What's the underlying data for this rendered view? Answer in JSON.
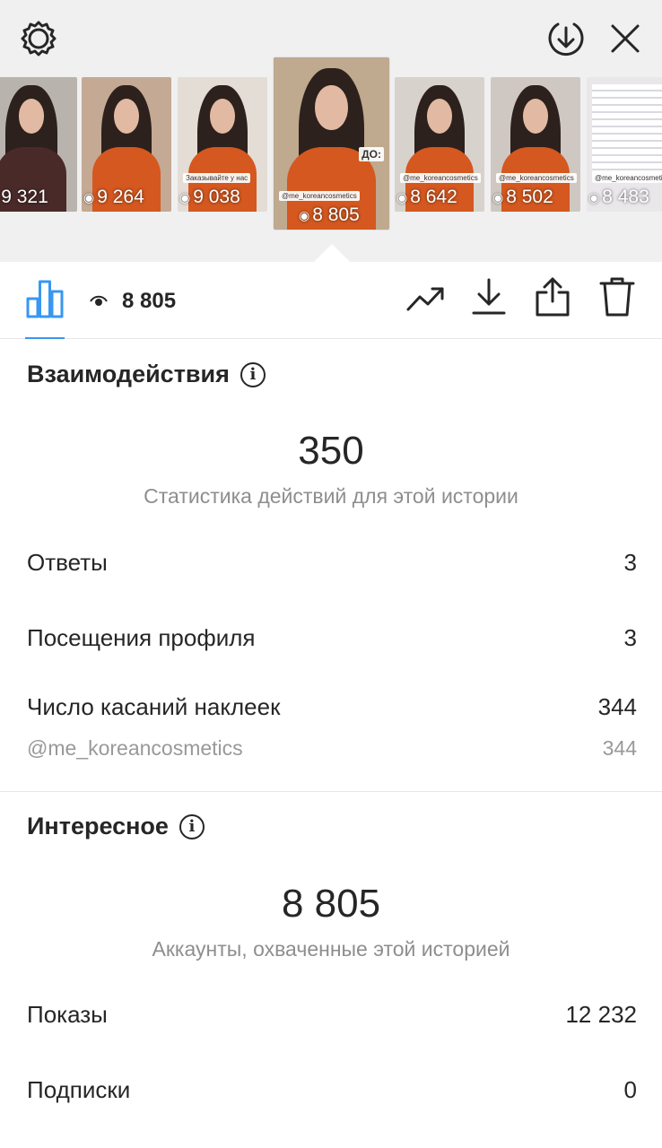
{
  "top_bar": {
    "settings_icon": "gear-icon",
    "download_icon": "download-circle-icon",
    "close_icon": "close-icon"
  },
  "stories": [
    {
      "views": "9 321",
      "caption": ""
    },
    {
      "views": "9 264",
      "caption": ""
    },
    {
      "views": "9 038",
      "caption": "Заказывайте у нас"
    },
    {
      "views": "8 805",
      "caption": "@me_koreancosmetics",
      "overlay": "ДО:",
      "selected": true
    },
    {
      "views": "8 642",
      "caption": "@me_koreancosmetics"
    },
    {
      "views": "8 502",
      "caption": "@me_koreancosmetics"
    },
    {
      "views": "8 483",
      "caption": "@me_koreancosmetics"
    }
  ],
  "toolbar": {
    "view_count": "8 805",
    "icons": [
      "bar-chart-icon",
      "eye-icon",
      "trend-icon",
      "download-icon",
      "share-icon",
      "trash-icon"
    ]
  },
  "interactions": {
    "title": "Взаимодействия",
    "total": "350",
    "subtitle": "Статистика действий для этой истории",
    "rows": [
      {
        "label": "Ответы",
        "value": "3"
      },
      {
        "label": "Посещения профиля",
        "value": "3"
      },
      {
        "label": "Число касаний наклеек",
        "value": "344"
      }
    ],
    "sub_row": {
      "label": "@me_koreancosmetics",
      "value": "344"
    }
  },
  "discovery": {
    "title": "Интересное",
    "total": "8 805",
    "subtitle": "Аккаунты, охваченные этой историей",
    "rows": [
      {
        "label": "Показы",
        "value": "12 232"
      },
      {
        "label": "Подписки",
        "value": "0"
      }
    ]
  },
  "colors": {
    "accent": "#3897f0",
    "sweater": "#d4581f",
    "background_top": "#f0f0f0"
  }
}
